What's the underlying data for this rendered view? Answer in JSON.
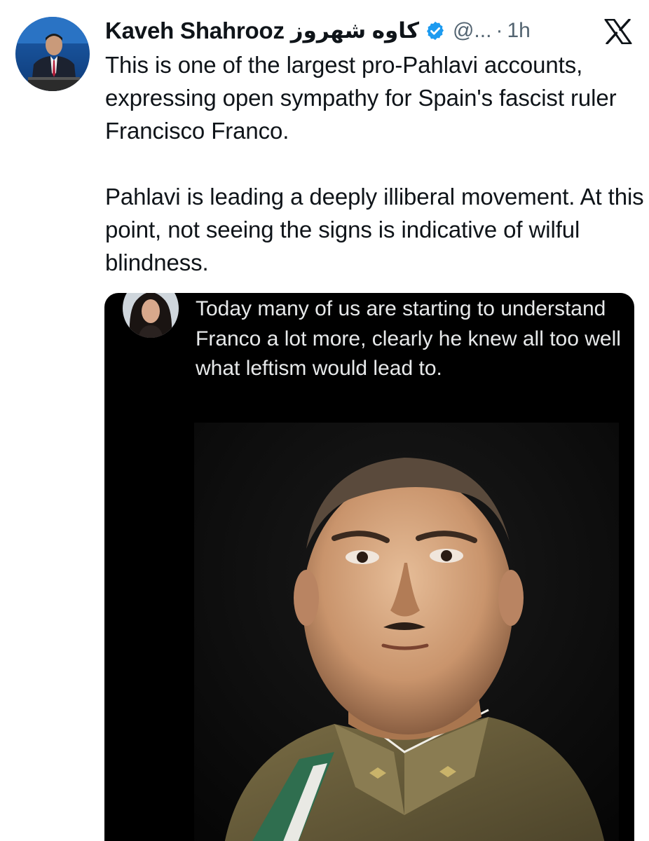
{
  "author": {
    "display_name": "Kaveh Shahrooz",
    "display_name_fa": "کاوه شهروز",
    "handle": "@...",
    "separator": "·",
    "time": "1h",
    "verified_icon": "verified-badge-icon"
  },
  "platform_logo": "x-logo-icon",
  "tweet": {
    "paragraphs": [
      "This is one of the largest pro-Pahlavi accounts, expressing open sympathy for Spain's fascist ruler Francisco Franco.",
      "Pahlavi is leading a deeply illiberal movement. At this point, not seeing the signs is indicative of wilful blindness."
    ]
  },
  "quoted_post": {
    "text": "Today many of us are starting to understand Franco a lot more, clearly he knew all too well what leftism would lead to."
  },
  "colors": {
    "text": "#0f1419",
    "secondary_text": "#536471",
    "verified": "#1d9bf0",
    "media_background": "#000000"
  }
}
